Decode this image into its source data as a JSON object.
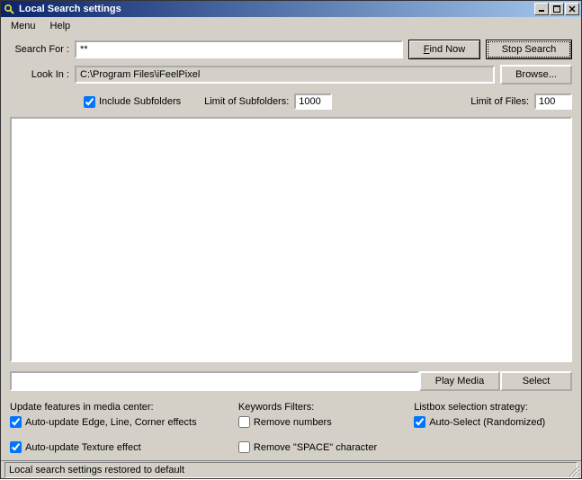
{
  "titlebar": {
    "title": "Local Search settings"
  },
  "menu": {
    "items": [
      "Menu",
      "Help"
    ]
  },
  "search": {
    "search_for_label": "Search For :",
    "search_for_value": "**",
    "find_now_label": "Find Now",
    "stop_search_label": "Stop Search",
    "look_in_label": "Look In :",
    "look_in_value": "C:\\Program Files\\iFeelPixel",
    "browse_label": "Browse..."
  },
  "options": {
    "include_subfolders_label": "Include Subfolders",
    "include_subfolders_checked": true,
    "limit_subfolders_label": "Limit of Subfolders:",
    "limit_subfolders_value": "1000",
    "limit_files_label": "Limit of Files:",
    "limit_files_value": "100"
  },
  "media": {
    "play_label": "Play Media",
    "select_label": "Select"
  },
  "updates": {
    "heading": "Update features in media center:",
    "edge_label": "Auto-update Edge, Line, Corner effects",
    "edge_checked": true,
    "texture_label": "Auto-update Texture effect",
    "texture_checked": true
  },
  "filters": {
    "heading": "Keywords Filters:",
    "remove_numbers_label": "Remove numbers",
    "remove_numbers_checked": false,
    "remove_space_label": "Remove \"SPACE\" character",
    "remove_space_checked": false
  },
  "strategy": {
    "heading": "Listbox selection strategy:",
    "auto_select_label": "Auto-Select (Randomized)",
    "auto_select_checked": true
  },
  "status": {
    "text": "Local search settings restored to default"
  }
}
